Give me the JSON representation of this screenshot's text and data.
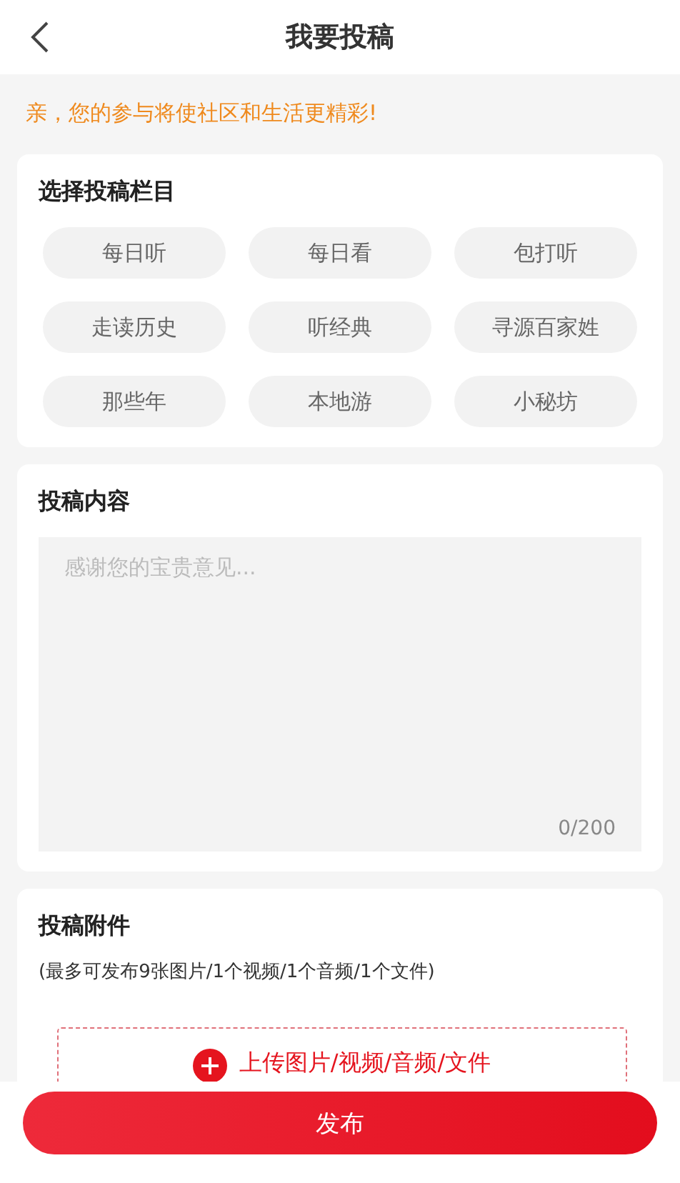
{
  "header": {
    "title": "我要投稿"
  },
  "notice": "亲，您的参与将使社区和生活更精彩!",
  "category_section": {
    "title": "选择投稿栏目",
    "categories": [
      {
        "label": "每日听",
        "selected": false
      },
      {
        "label": "每日看",
        "selected": false
      },
      {
        "label": "包打听",
        "selected": false
      },
      {
        "label": "走读历史",
        "selected": false
      },
      {
        "label": "听经典",
        "selected": false
      },
      {
        "label": "寻源百家姓",
        "selected": false
      },
      {
        "label": "那些年",
        "selected": false
      },
      {
        "label": "本地游",
        "selected": false
      },
      {
        "label": "小秘坊",
        "selected": false
      }
    ]
  },
  "content_section": {
    "title": "投稿内容",
    "placeholder": "感谢您的宝贵意见...",
    "counter": "0/200"
  },
  "attachment_section": {
    "title": "投稿附件",
    "hint": "(最多可发布9张图片/1个视频/1个音频/1个文件)",
    "upload_label": "上传图片/视频/音频/文件"
  },
  "submit_button": "发布"
}
